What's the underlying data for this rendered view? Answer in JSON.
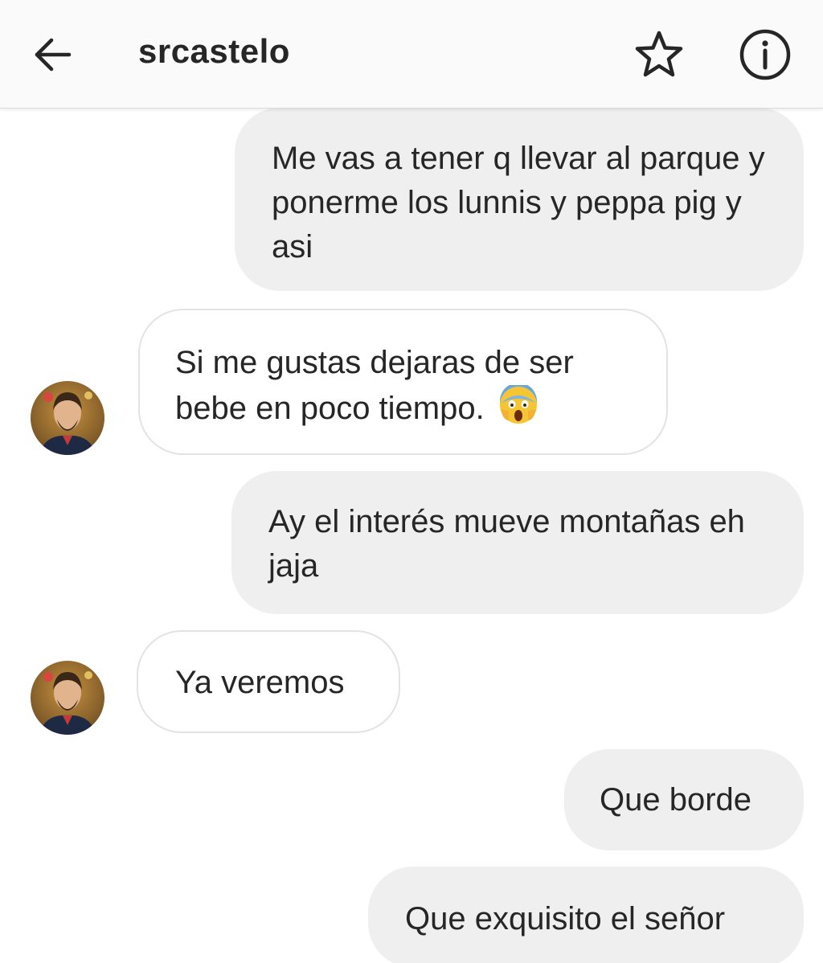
{
  "header": {
    "title": "srcastelo",
    "back_icon": "arrow-left-icon",
    "star_icon": "star-outline-icon",
    "info_icon": "info-circle-icon"
  },
  "messages": [
    {
      "direction": "outgoing",
      "text": "Me vas a tener q llevar al parque y ponerme los lunnis y peppa pig y asi"
    },
    {
      "direction": "incoming",
      "text": "Si me gustas dejaras de ser bebe en poco tiempo.",
      "emoji": "face-screaming-in-fear"
    },
    {
      "direction": "outgoing",
      "text": "Ay el interés mueve montañas eh jaja"
    },
    {
      "direction": "incoming",
      "text": "Ya veremos"
    },
    {
      "direction": "outgoing",
      "text": "Que borde"
    },
    {
      "direction": "outgoing",
      "text": "Que exquisito el señor"
    }
  ],
  "colors": {
    "header_bg": "#fafafa",
    "outgoing_bubble": "#efefef",
    "incoming_border": "#e3e3e3",
    "text": "#262626"
  }
}
